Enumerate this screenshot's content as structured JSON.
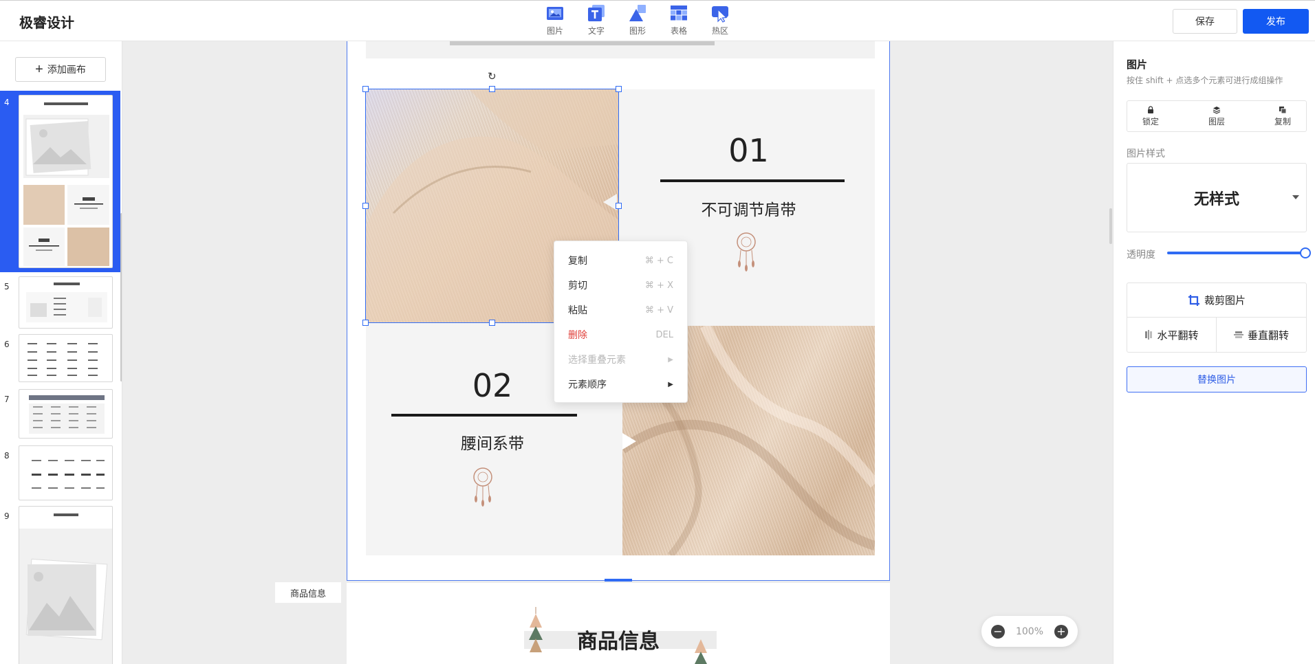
{
  "app": {
    "title": "极睿设计"
  },
  "toolbar": {
    "tools": [
      {
        "label": "图片",
        "icon": "image-icon"
      },
      {
        "label": "文字",
        "icon": "text-icon"
      },
      {
        "label": "图形",
        "icon": "shape-icon"
      },
      {
        "label": "表格",
        "icon": "table-icon"
      },
      {
        "label": "热区",
        "icon": "hotspot-icon"
      }
    ],
    "save_label": "保存",
    "publish_label": "发布"
  },
  "left_panel": {
    "add_canvas_label": "添加画布",
    "thumbnails": [
      {
        "number": "4",
        "active": true
      },
      {
        "number": "5",
        "active": false
      },
      {
        "number": "6",
        "active": false
      },
      {
        "number": "7",
        "active": false
      },
      {
        "number": "8",
        "active": false
      },
      {
        "number": "9",
        "active": false
      }
    ]
  },
  "canvas": {
    "feature1": {
      "number": "01",
      "title": "不可调节肩带"
    },
    "feature2": {
      "number": "02",
      "title": "腰间系带"
    },
    "section_tag": "商品信息",
    "lower_title": "商品信息",
    "zoom": "100%"
  },
  "context_menu": {
    "items": [
      {
        "label": "复制",
        "shortcut": "⌘ + C",
        "style": "normal"
      },
      {
        "label": "剪切",
        "shortcut": "⌘ + X",
        "style": "normal"
      },
      {
        "label": "粘贴",
        "shortcut": "⌘ + V",
        "style": "normal"
      },
      {
        "label": "删除",
        "shortcut": "DEL",
        "style": "danger"
      },
      {
        "label": "选择重叠元素",
        "shortcut": "",
        "style": "disabled",
        "submenu": true
      },
      {
        "label": "元素顺序",
        "shortcut": "",
        "style": "normal",
        "submenu": true
      }
    ]
  },
  "right_panel": {
    "title": "图片",
    "hint": "按住 shift + 点选多个元素可进行成组操作",
    "actions": [
      {
        "label": "锁定",
        "icon": "lock-icon"
      },
      {
        "label": "图层",
        "icon": "layers-icon"
      },
      {
        "label": "复制",
        "icon": "copy-icon"
      }
    ],
    "style_label": "图片样式",
    "style_value": "无样式",
    "opacity_label": "透明度",
    "opacity_value": 1.0,
    "crop_label": "裁剪图片",
    "flip_h_label": "水平翻转",
    "flip_v_label": "垂直翻转",
    "replace_label": "替换图片"
  },
  "colors": {
    "accent": "#1259f2",
    "danger": "#e0403a",
    "selection": "#2f6bf4"
  }
}
